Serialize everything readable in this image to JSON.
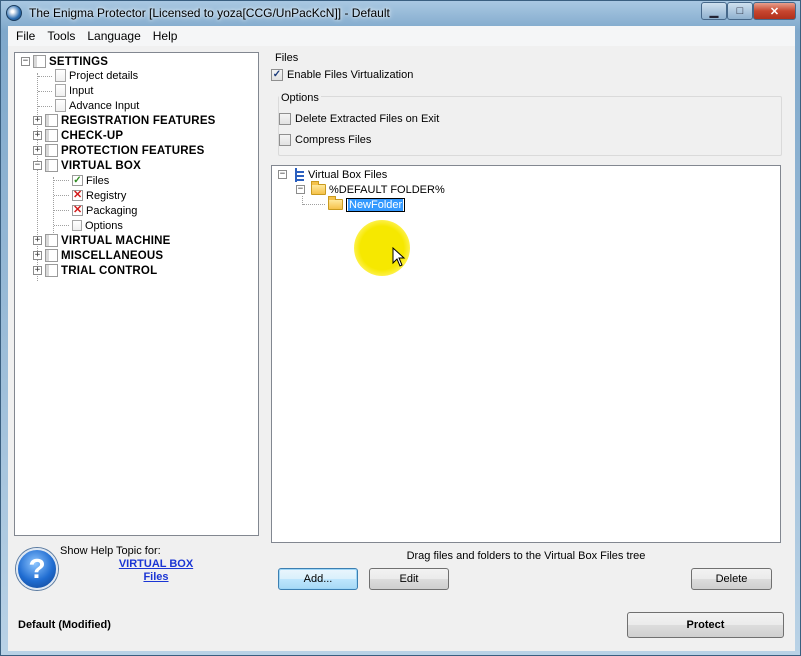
{
  "window": {
    "title": "The Enigma Protector [Licensed to yoza[CCG/UnPacKcN]] - Default"
  },
  "menu": [
    "File",
    "Tools",
    "Language",
    "Help"
  ],
  "settings_tree": {
    "root": "SETTINGS",
    "items": [
      {
        "label": "Project details",
        "level": 2,
        "icon": "page-icon"
      },
      {
        "label": "Input",
        "level": 2,
        "icon": "page-icon"
      },
      {
        "label": "Advance Input",
        "level": 2,
        "icon": "page-icon"
      },
      {
        "label": "REGISTRATION FEATURES",
        "level": 1,
        "icon": "book-icon",
        "expander": "+"
      },
      {
        "label": "CHECK-UP",
        "level": 1,
        "icon": "book-icon",
        "expander": "+"
      },
      {
        "label": "PROTECTION FEATURES",
        "level": 1,
        "icon": "book-icon",
        "expander": "+"
      },
      {
        "label": "VIRTUAL BOX",
        "level": 1,
        "icon": "book-icon",
        "expander": "-"
      },
      {
        "label": "Files",
        "level": 3,
        "icon": "checkmark-icon"
      },
      {
        "label": "Registry",
        "level": 3,
        "icon": "cross-icon"
      },
      {
        "label": "Packaging",
        "level": 3,
        "icon": "cross-icon"
      },
      {
        "label": "Options",
        "level": 3,
        "icon": "page-icon"
      },
      {
        "label": "VIRTUAL MACHINE",
        "level": 1,
        "icon": "book-icon",
        "expander": "+"
      },
      {
        "label": "MISCELLANEOUS",
        "level": 1,
        "icon": "book-icon",
        "expander": "+"
      },
      {
        "label": "TRIAL CONTROL",
        "level": 1,
        "icon": "book-icon",
        "expander": "+"
      }
    ]
  },
  "help": {
    "caption": "Show Help Topic for:",
    "link_line1": "VIRTUAL BOX",
    "link_line2": "Files"
  },
  "status": "Default  (Modified)",
  "files_panel": {
    "group_label": "Files",
    "enable_virtualization": {
      "label": "Enable Files Virtualization",
      "checked": true
    },
    "options_label": "Options",
    "delete_on_exit": {
      "label": "Delete Extracted Files on Exit",
      "checked": false
    },
    "compress_files": {
      "label": "Compress Files",
      "checked": false
    }
  },
  "vbox_tree": {
    "root": "Virtual Box Files",
    "default_folder": "%DEFAULT FOLDER%",
    "editing_folder": "NewFolder"
  },
  "drag_hint": "Drag files and folders to the Virtual Box Files tree",
  "buttons": {
    "add": "Add...",
    "edit": "Edit",
    "delete": "Delete",
    "protect": "Protect"
  },
  "colors": {
    "link": "#1a35d4",
    "highlight": "#f6e800",
    "selection": "#3399ff"
  }
}
